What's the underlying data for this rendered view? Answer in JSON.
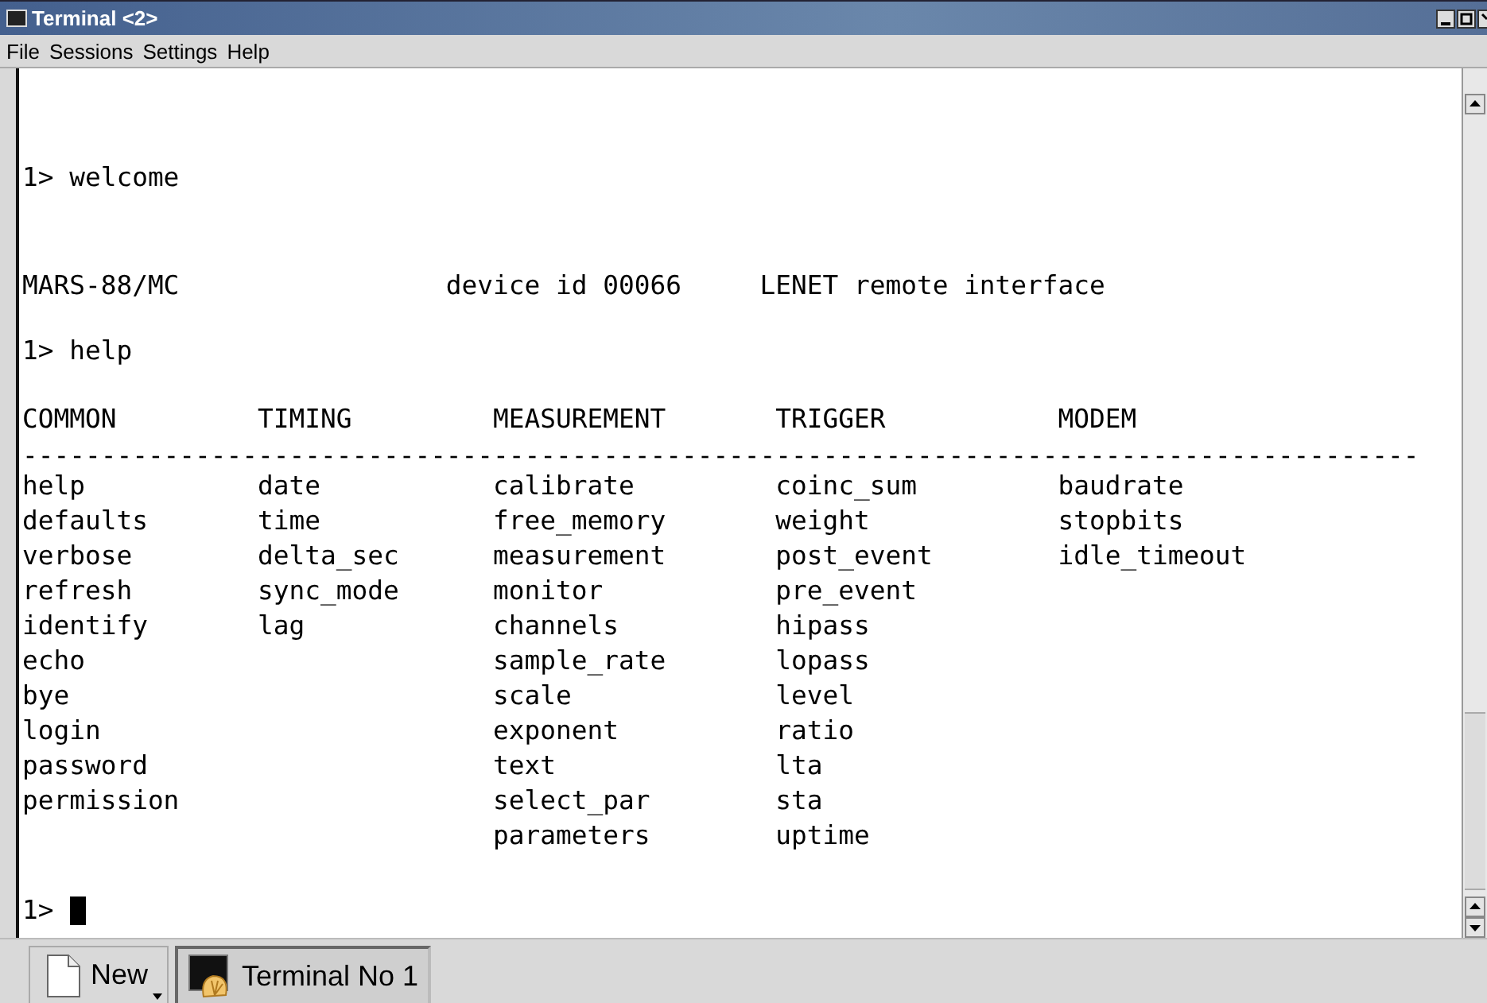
{
  "window": {
    "title": "Terminal <2>"
  },
  "menu": [
    "File",
    "Sessions",
    "Settings",
    "Help"
  ],
  "terminal": {
    "welcome_line": "1> welcome",
    "banner": [
      "MARS-88/MC",
      "device id 00066",
      "LENET remote interface"
    ],
    "help_line": "1> help",
    "help_columns": [
      {
        "heading": "COMMON",
        "commands": [
          "help",
          "defaults",
          "verbose",
          "refresh",
          "identify",
          "echo",
          "bye",
          "login",
          "password",
          "permission"
        ]
      },
      {
        "heading": "TIMING",
        "commands": [
          "date",
          "time",
          "delta_sec",
          "sync_mode",
          "lag"
        ]
      },
      {
        "heading": "MEASUREMENT",
        "commands": [
          "calibrate",
          "free_memory",
          "measurement",
          "monitor",
          "channels",
          "sample_rate",
          "scale",
          "exponent",
          "text",
          "select_par",
          "parameters"
        ]
      },
      {
        "heading": "TRIGGER",
        "commands": [
          "coinc_sum",
          "weight",
          "post_event",
          "pre_event",
          "hipass",
          "lopass",
          "level",
          "ratio",
          "lta",
          "sta",
          "uptime"
        ]
      },
      {
        "heading": "MODEM",
        "commands": [
          "baudrate",
          "stopbits",
          "idle_timeout"
        ]
      }
    ],
    "separator": "-----------------------------------------------------------------------------------------",
    "prompt": "1>"
  },
  "tab_bar": {
    "new_button": "New",
    "tabs": [
      {
        "label": "Terminal No 1",
        "selected": true
      }
    ]
  }
}
